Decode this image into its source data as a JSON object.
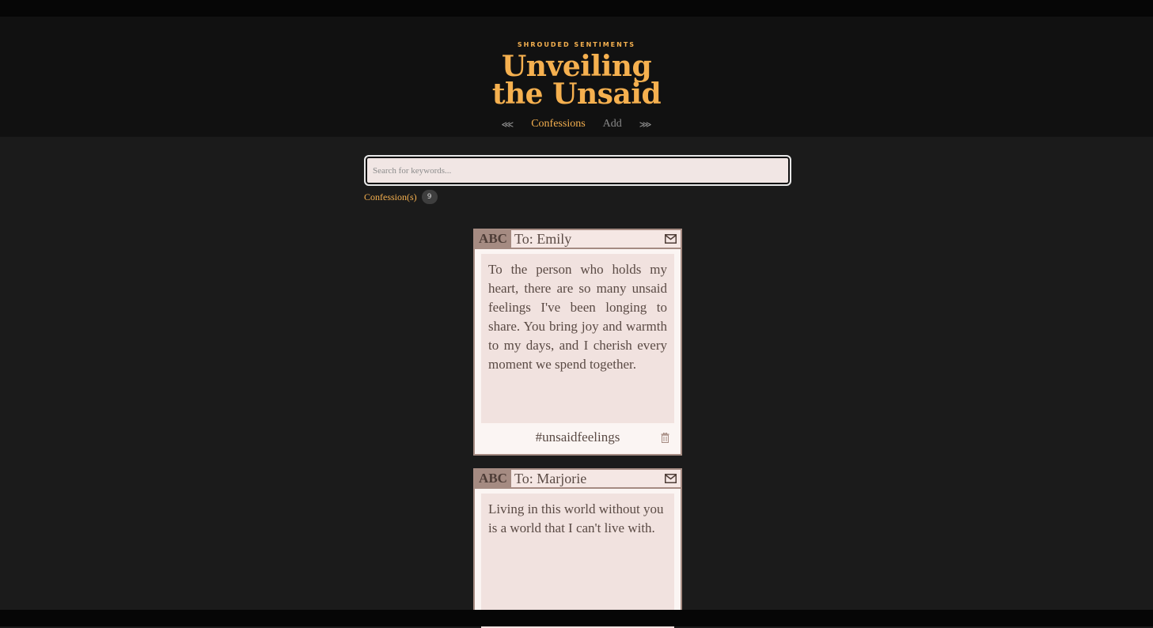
{
  "header": {
    "eyebrow": "SHROUDED SENTIMENTS",
    "title_line1": "Unveiling",
    "title_line2": "the Unsaid"
  },
  "nav": {
    "prev": "⋘",
    "confessions": "Confessions",
    "add": "Add",
    "next": "⋙"
  },
  "search": {
    "placeholder": "Search for keywords..."
  },
  "counter": {
    "label": "Confession(s)",
    "count": "9"
  },
  "cards": [
    {
      "badge": "ABC",
      "to": "To: Emily",
      "message": "To the person who holds my heart, there are so many unsaid feelings I've been longing to share. You bring joy and warmth to my days, and I cherish every moment we spend together.",
      "hashtag": "#unsaidfeelings"
    },
    {
      "badge": "ABC",
      "to": "To: Marjorie",
      "message": "Living in this world without you is a world that I can't live with."
    }
  ],
  "colors": {
    "accent": "#f5b04f",
    "card_border": "#a58b82",
    "card_body": "#f1e2df"
  },
  "icons": {
    "mail": "mail-icon",
    "trash": "trash-icon"
  }
}
